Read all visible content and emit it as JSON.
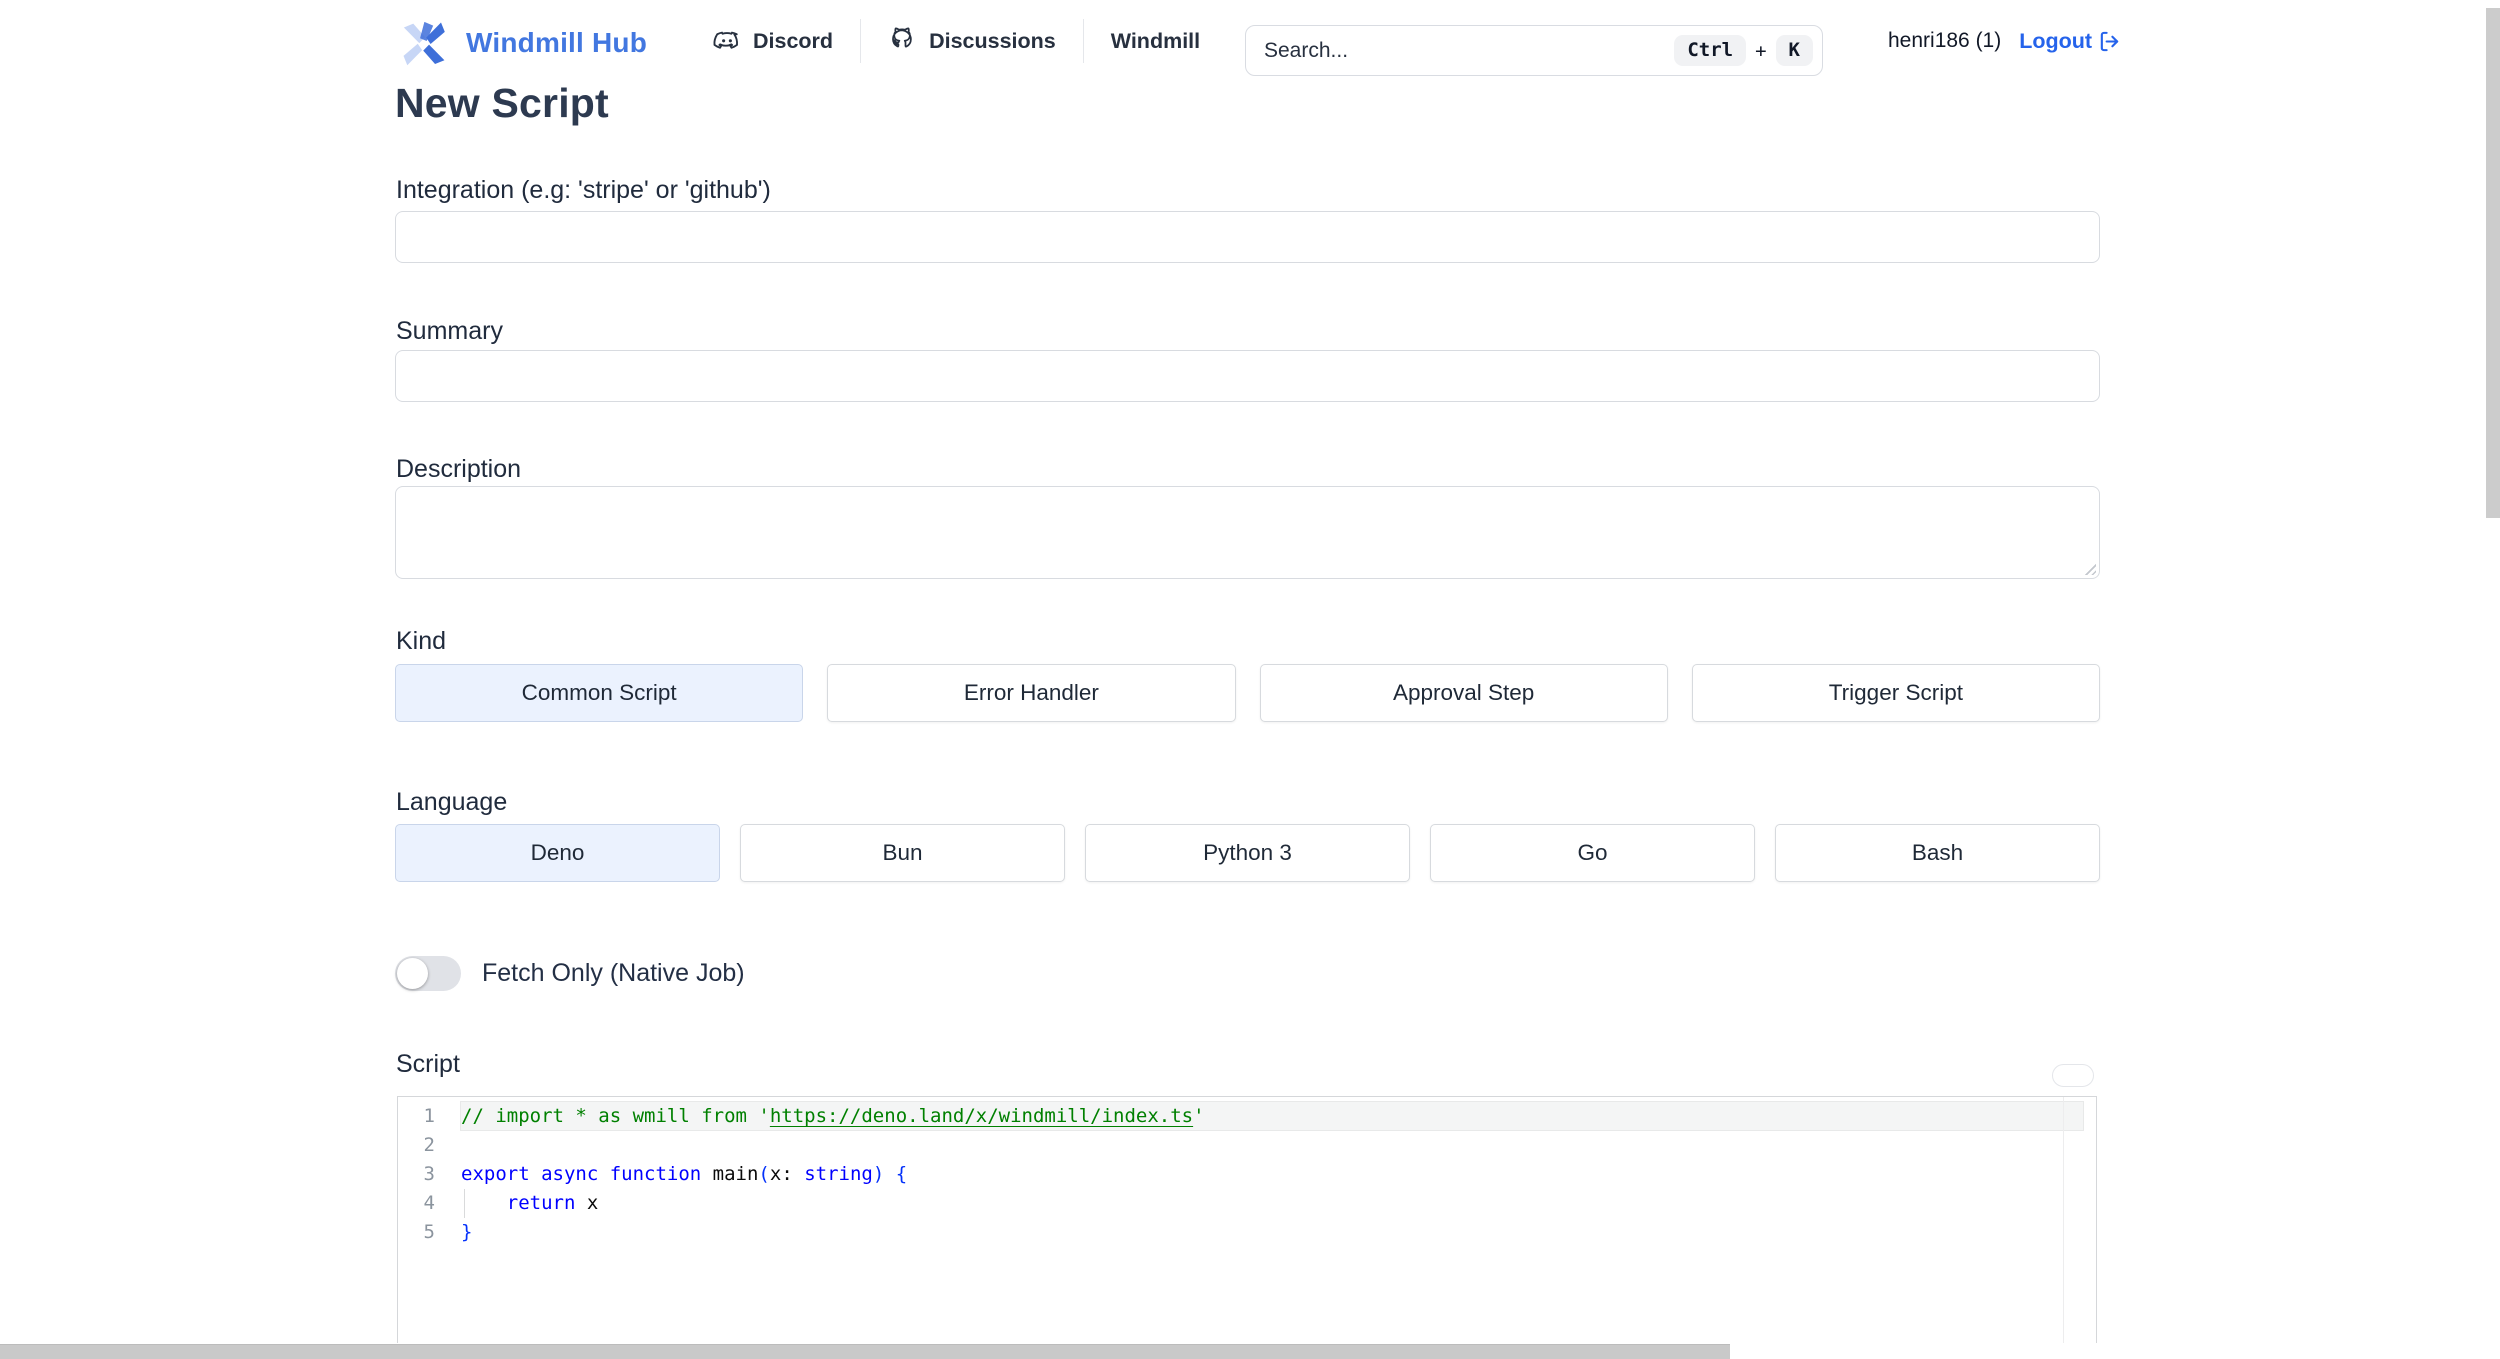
{
  "header": {
    "brand": "Windmill Hub",
    "nav": [
      {
        "label": "Discord",
        "icon": "discord-icon"
      },
      {
        "label": "Discussions",
        "icon": "github-icon"
      },
      {
        "label": "Windmill",
        "icon": "none"
      }
    ],
    "search": {
      "placeholder": "Search...",
      "kbd_ctrl": "Ctrl",
      "kbd_plus": "+",
      "kbd_k": "K"
    },
    "account": {
      "username": "henri186 (1)",
      "logout_label": "Logout"
    }
  },
  "page": {
    "title": "New Script"
  },
  "form": {
    "integration": {
      "label": "Integration (e.g: 'stripe' or 'github')",
      "value": ""
    },
    "summary": {
      "label": "Summary",
      "value": ""
    },
    "description": {
      "label": "Description",
      "value": ""
    },
    "kind": {
      "label": "Kind",
      "options": [
        "Common Script",
        "Error Handler",
        "Approval Step",
        "Trigger Script"
      ],
      "selected": "Common Script"
    },
    "language": {
      "label": "Language",
      "options": [
        "Deno",
        "Bun",
        "Python 3",
        "Go",
        "Bash"
      ],
      "selected": "Deno"
    },
    "fetch_only": {
      "label": "Fetch Only (Native Job)",
      "enabled": false
    }
  },
  "editor": {
    "label": "Script",
    "code_plain": "// import * as wmill from 'https://deno.land/x/windmill/index.ts'\n\nexport async function main(x: string) {\n    return x\n}",
    "lines": [
      {
        "num": "1",
        "tokens": [
          {
            "t": "// import * as wmill from '",
            "c": "comment"
          },
          {
            "t": "https://deno.land/x/windmill/index.ts",
            "c": "comment-link"
          },
          {
            "t": "'",
            "c": "comment"
          }
        ]
      },
      {
        "num": "2",
        "tokens": []
      },
      {
        "num": "3",
        "tokens": [
          {
            "t": "export async function",
            "c": "keyword"
          },
          {
            "t": " main",
            "c": "plain"
          },
          {
            "t": "(",
            "c": "bracket"
          },
          {
            "t": "x: ",
            "c": "plain"
          },
          {
            "t": "string",
            "c": "keyword"
          },
          {
            "t": ") {",
            "c": "bracket"
          }
        ]
      },
      {
        "num": "4",
        "tokens": [
          {
            "t": "    ",
            "c": "plain"
          },
          {
            "t": "return",
            "c": "keyword"
          },
          {
            "t": " x",
            "c": "plain"
          }
        ]
      },
      {
        "num": "5",
        "tokens": [
          {
            "t": "}",
            "c": "bracket"
          }
        ]
      }
    ]
  },
  "colors": {
    "brand_blue": "#4277e0",
    "link_blue": "#2563eb",
    "selected_bg": "#ebf2fe",
    "comment_green": "#008000",
    "keyword_blue": "#0000ff",
    "bracket_blue": "#0431fa",
    "scrollbar_gray": "#c9c9c9"
  }
}
